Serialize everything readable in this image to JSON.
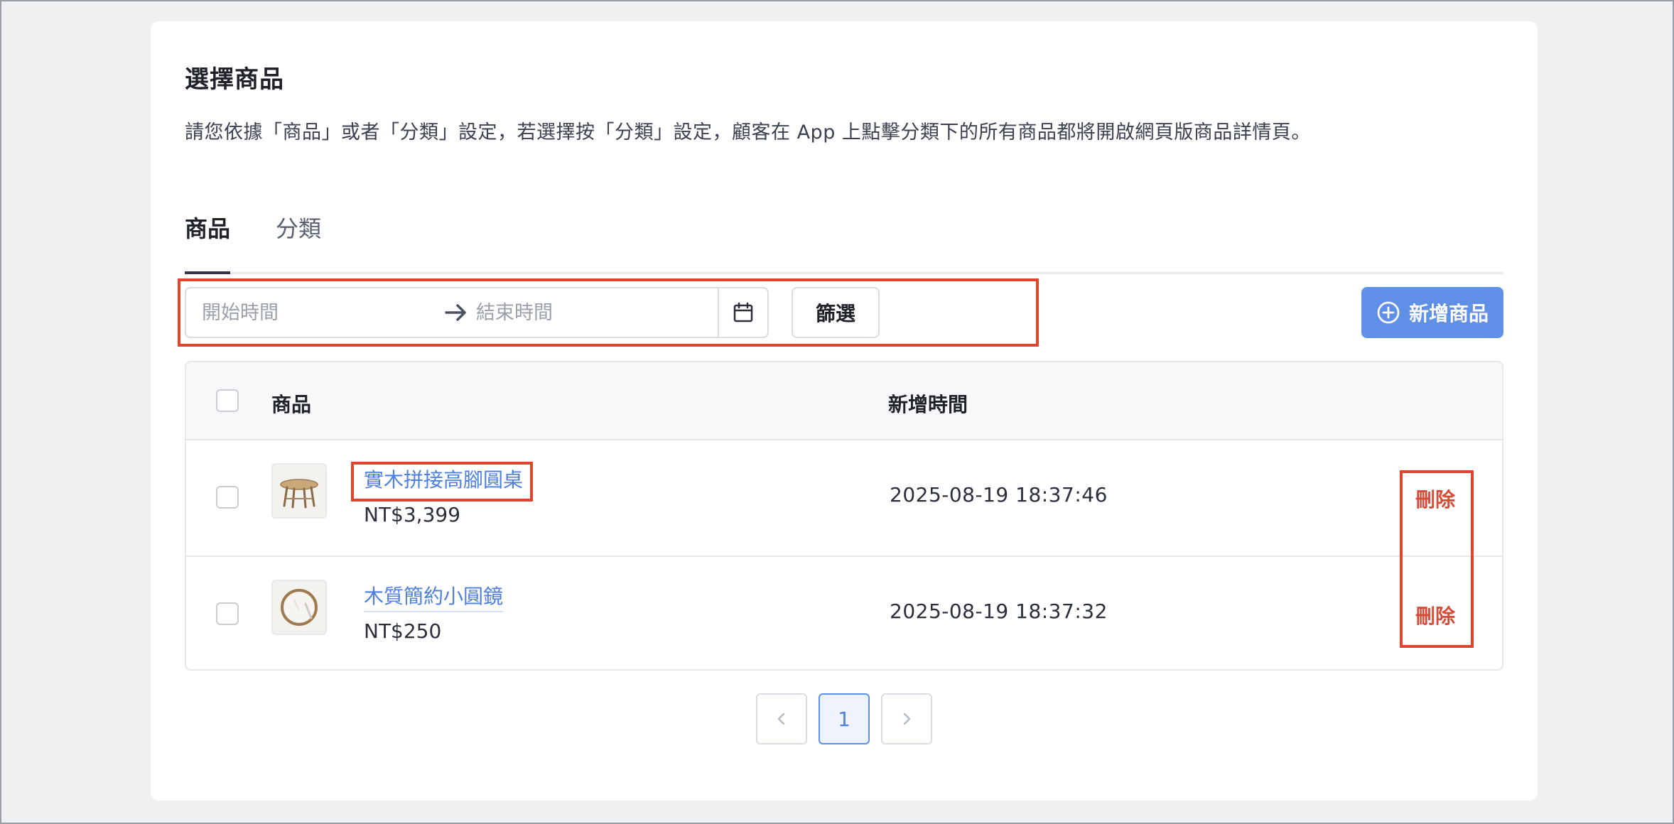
{
  "header": {
    "title": "選擇商品",
    "description": "請您依據「商品」或者「分類」設定，若選擇按「分類」設定，顧客在 App 上點擊分類下的所有商品都將開啟網頁版商品詳情頁。"
  },
  "tabs": [
    {
      "label": "商品",
      "active": true
    },
    {
      "label": "分類",
      "active": false
    }
  ],
  "filter": {
    "start_placeholder": "開始時間",
    "end_placeholder": "結束時間",
    "filter_button": "篩選"
  },
  "actions": {
    "add_button": "新增商品"
  },
  "table": {
    "columns": [
      "商品",
      "新增時間"
    ],
    "rows": [
      {
        "name": "實木拼接高腳圓桌",
        "price": "NT$3,399",
        "created": "2025-08-19 18:37:46",
        "action": "刪除",
        "thumb": "table-icon"
      },
      {
        "name": "木質簡約小圓鏡",
        "price": "NT$250",
        "created": "2025-08-19 18:37:32",
        "action": "刪除",
        "thumb": "mirror-icon"
      }
    ]
  },
  "pagination": {
    "current": "1"
  },
  "colors": {
    "accent": "#5f8fe6",
    "link": "#4d7fe0",
    "danger": "#d64a36",
    "highlight": "#e0432e"
  }
}
